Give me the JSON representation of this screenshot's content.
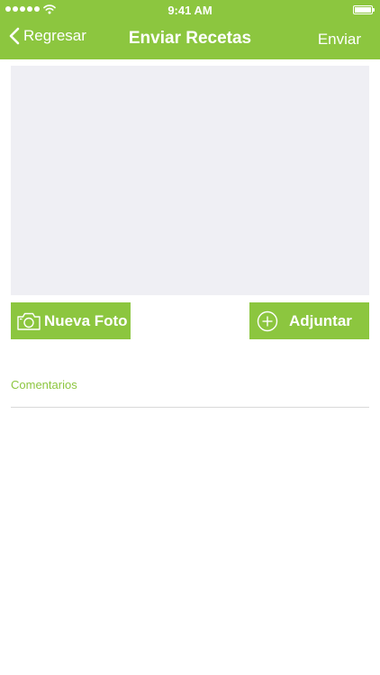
{
  "status_bar": {
    "time": "9:41 AM"
  },
  "nav": {
    "back_label": "Regresar",
    "title": "Enviar Recetas",
    "send_label": "Enviar"
  },
  "actions": {
    "new_photo_label": "Nueva Foto",
    "attach_label": "Adjuntar"
  },
  "form": {
    "comments_label": "Comentarios",
    "comments_value": ""
  },
  "colors": {
    "brand_green": "#8cc63f",
    "photo_placeholder_bg": "#efeff4",
    "divider": "#d9d9d9"
  },
  "icons": {
    "back": "chevron-left-icon",
    "new_photo": "camera-icon",
    "attach": "plus-circle-icon"
  }
}
